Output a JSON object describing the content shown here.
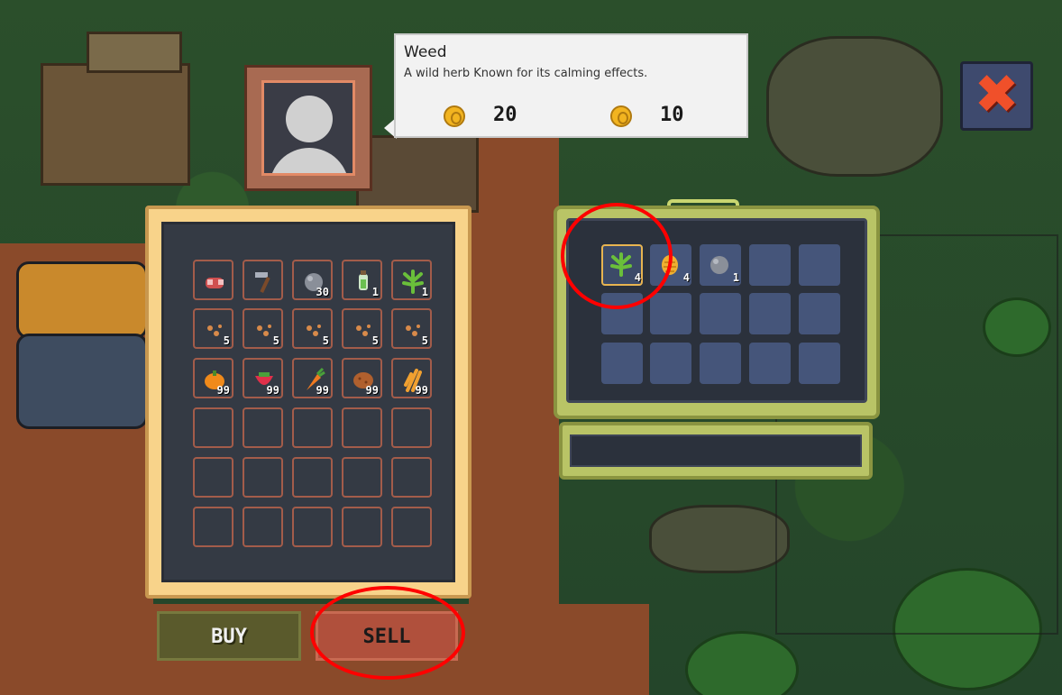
{
  "tooltip": {
    "title": "Weed",
    "description": "A wild herb Known for its calming effects.",
    "buy_price": "20",
    "sell_price": "10",
    "coin_icon": "gold-coin-icon"
  },
  "buttons": {
    "buy_label": "BUY",
    "sell_label": "SELL",
    "close_label": "✖"
  },
  "shop": {
    "rows": [
      [
        {
          "icon": "meat-icon",
          "count": ""
        },
        {
          "icon": "hammer-icon",
          "count": ""
        },
        {
          "icon": "stone-icon",
          "count": "30"
        },
        {
          "icon": "potion-icon",
          "count": "1"
        },
        {
          "icon": "weed-icon",
          "count": "1"
        }
      ],
      [
        {
          "icon": "seeds-icon",
          "count": "5"
        },
        {
          "icon": "seeds-icon",
          "count": "5"
        },
        {
          "icon": "seeds-icon",
          "count": "5"
        },
        {
          "icon": "seeds-icon",
          "count": "5"
        },
        {
          "icon": "seeds-icon",
          "count": "5"
        }
      ],
      [
        {
          "icon": "pumpkin-icon",
          "count": "99"
        },
        {
          "icon": "strawberry-icon",
          "count": "99"
        },
        {
          "icon": "carrot-icon",
          "count": "99"
        },
        {
          "icon": "potato-icon",
          "count": "99"
        },
        {
          "icon": "wheat-icon",
          "count": "99"
        }
      ]
    ]
  },
  "storage": {
    "items": [
      {
        "icon": "weed-icon",
        "count": "4",
        "selected": true
      },
      {
        "icon": "corn-icon",
        "count": "4",
        "selected": false
      },
      {
        "icon": "stone-icon",
        "count": "1",
        "selected": false
      }
    ]
  },
  "colors": {
    "annotation": "#ff0000",
    "shop_frame": "#f8d38a",
    "storage_frame": "#b9c466"
  }
}
